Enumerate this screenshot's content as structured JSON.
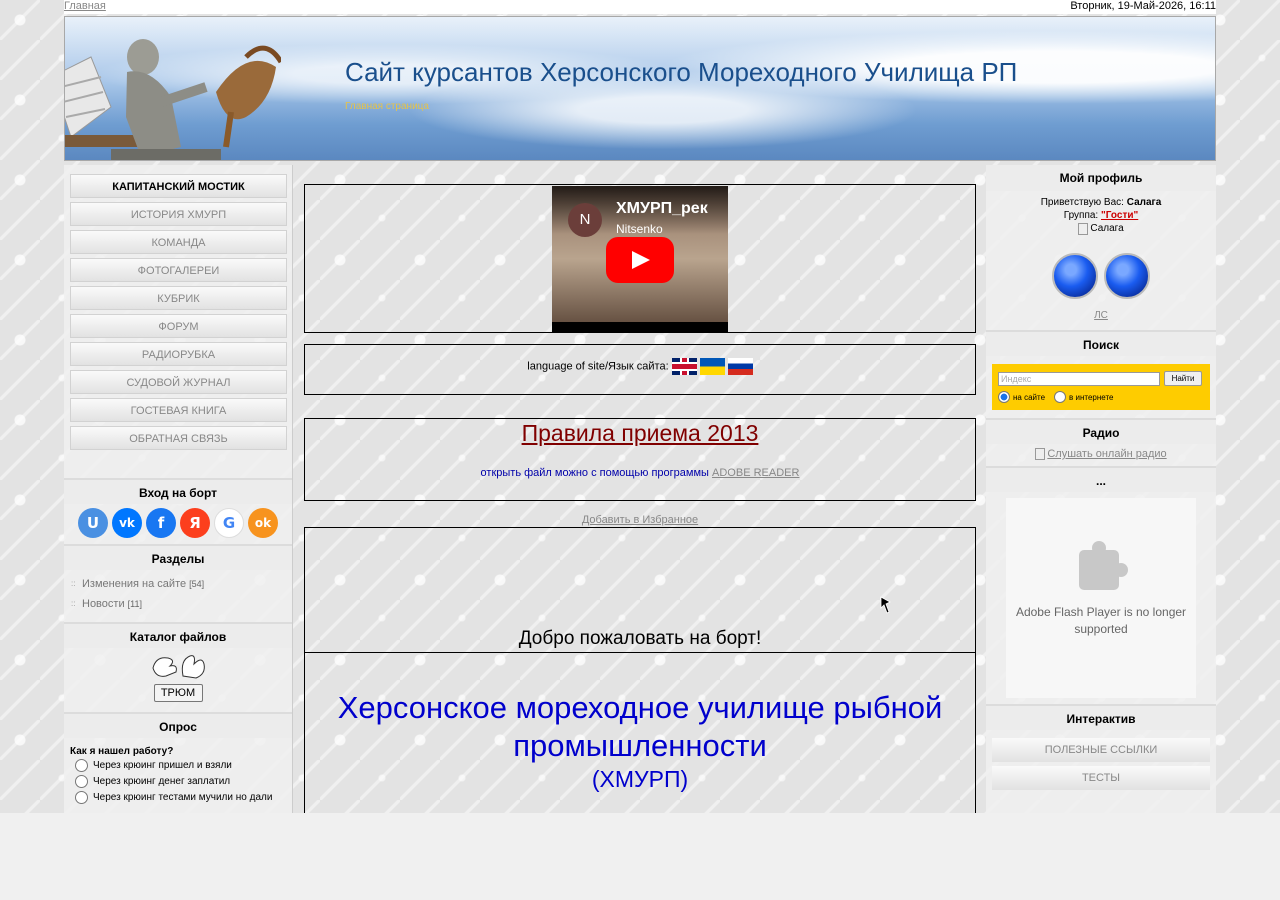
{
  "topbar": {
    "home_link": "Главная",
    "date": "Вторник, 19-Май-2026, 16:11"
  },
  "header": {
    "title": "Сайт курсантов Херсонского Мореходного Училища РП",
    "subtitle": "Главная страница"
  },
  "left_menu": {
    "items": [
      "КАПИТАНСКИЙ МОСТИК",
      "ИСТОРИЯ ХМУРП",
      "КОМАНДА",
      "ФОТОГАЛЕРЕИ",
      "КУБРИК",
      "ФОРУМ",
      "РАДИОРУБКА",
      "СУДОВОЙ ЖУРНАЛ",
      "ГОСТЕВАЯ КНИГА",
      "ОБРАТНАЯ СВЯЗЬ"
    ]
  },
  "login": {
    "title": "Вход на борт",
    "providers": [
      "uID",
      "ВКонтакте",
      "Facebook",
      "Яндекс",
      "Google",
      "Одноклассники"
    ],
    "glyphs": [
      "U",
      "vk",
      "f",
      "Я",
      "G",
      "ok"
    ]
  },
  "sections": {
    "title": "Разделы",
    "items": [
      {
        "label": "Изменения на сайте",
        "count": "[54]"
      },
      {
        "label": "Новости",
        "count": "[11]"
      }
    ]
  },
  "files": {
    "title": "Каталог файлов",
    "button": "ТРЮМ"
  },
  "poll": {
    "title": "Опрос",
    "question": "Как я нашел работу?",
    "options": [
      "Через крюинг пришел и взяли",
      "Через крюинг денег заплатил",
      "Через крюинг тестами мучили но дали"
    ]
  },
  "center": {
    "video": {
      "title": "ХМУРП_рек",
      "channel": "Nitsenko",
      "avatar": "N"
    },
    "language_label": "language of site/Язык сайта:",
    "rules_title": "Правила приема 2013",
    "rules_note": "открыть файл можно с помощью программы",
    "rules_link": "ADOBE READER",
    "add_favorites": "Добавить в Избранное",
    "welcome": "Добро пожаловать на борт!",
    "school_name": "Херсонское мореходное училище рыбной промышленности",
    "school_abbr": "(ХМУРП)"
  },
  "profile": {
    "title": "Мой профиль",
    "greeting_prefix": "Приветствую Вас:",
    "user": "Салага",
    "group_prefix": "Группа:",
    "group": "\"Гости\"",
    "avatar_alt": "Салага",
    "ls_link": "ЛС"
  },
  "search": {
    "title": "Поиск",
    "placeholder": "Индекс",
    "button": "Найти",
    "opt_site": "на сайте",
    "opt_web": "в интернете"
  },
  "radio": {
    "title": "Радио",
    "link": "Слушать онлайн радио"
  },
  "flash": {
    "title": "...",
    "message": "Adobe Flash Player is no longer supported"
  },
  "interactive": {
    "title": "Интерактив",
    "items": [
      "ПОЛЕЗНЫЕ ССЫЛКИ",
      "ТЕСТЫ"
    ]
  },
  "colors": {
    "accent_blue": "#0000cc",
    "rules_red": "#800000",
    "search_yellow": "#fecc00",
    "group_red": "#cc0000",
    "title_blue": "#1a4f8c"
  }
}
